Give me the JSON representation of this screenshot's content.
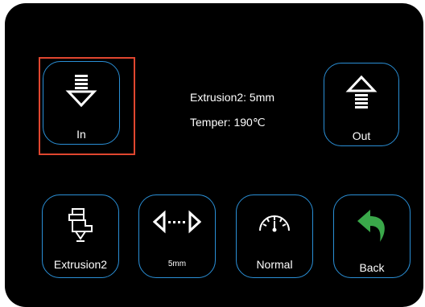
{
  "header": {},
  "extrude": {
    "in_label": "In",
    "out_label": "Out"
  },
  "status": {
    "extrusion_text": "Extrusion2: 5mm",
    "temper_text": "Temper: 190℃"
  },
  "bottom": {
    "extruder_label": "Extrusion2",
    "distance_label": "5mm",
    "speed_label": "Normal",
    "back_label": "Back"
  },
  "colors": {
    "button_border": "#2a8fd6",
    "selection_outline": "#e0462f",
    "back_arrow": "#3aa84a",
    "background": "#000000",
    "text": "#ffffff"
  },
  "icons": [
    "extrude-in-icon",
    "extrude-out-icon",
    "extruder-icon",
    "distance-icon",
    "speed-gauge-icon",
    "back-arrow-icon"
  ]
}
